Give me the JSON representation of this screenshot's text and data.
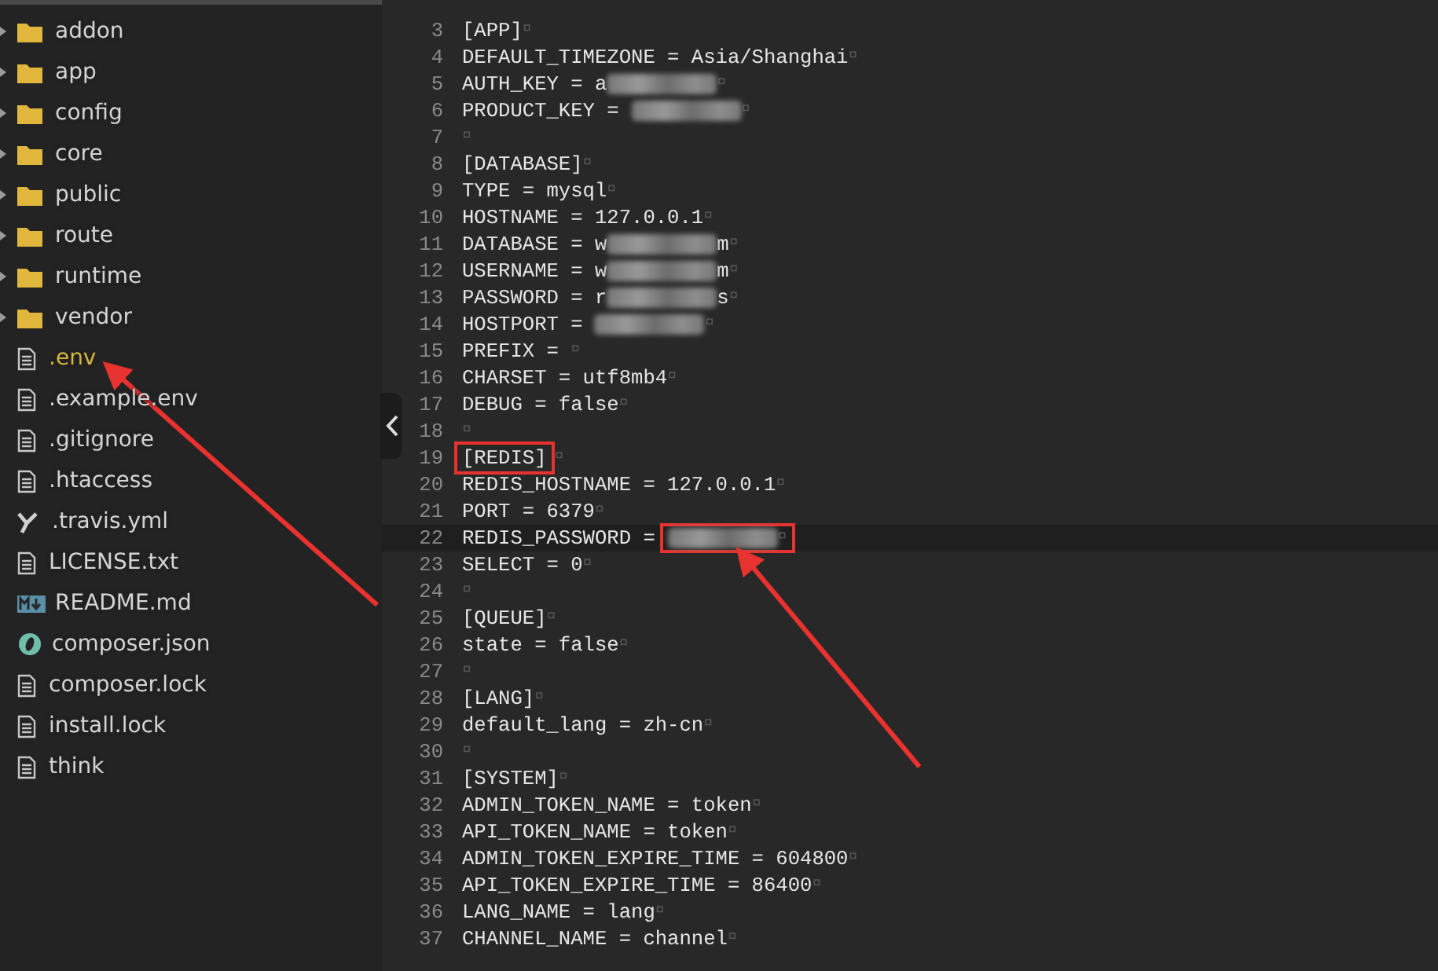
{
  "sidebar": {
    "items": [
      {
        "kind": "folder",
        "label": "addon",
        "selected": false
      },
      {
        "kind": "folder",
        "label": "app",
        "selected": false
      },
      {
        "kind": "folder",
        "label": "config",
        "selected": false
      },
      {
        "kind": "folder",
        "label": "core",
        "selected": false
      },
      {
        "kind": "folder",
        "label": "public",
        "selected": false
      },
      {
        "kind": "folder",
        "label": "route",
        "selected": false
      },
      {
        "kind": "folder",
        "label": "runtime",
        "selected": false
      },
      {
        "kind": "folder",
        "label": "vendor",
        "selected": false
      },
      {
        "kind": "file",
        "label": ".env",
        "selected": true
      },
      {
        "kind": "file",
        "label": ".example.env",
        "selected": false
      },
      {
        "kind": "file",
        "label": ".gitignore",
        "selected": false
      },
      {
        "kind": "file",
        "label": ".htaccess",
        "selected": false
      },
      {
        "kind": "yaml",
        "label": ".travis.yml",
        "selected": false
      },
      {
        "kind": "file",
        "label": "LICENSE.txt",
        "selected": false
      },
      {
        "kind": "markdown",
        "label": "README.md",
        "selected": false
      },
      {
        "kind": "json",
        "label": "composer.json",
        "selected": false
      },
      {
        "kind": "file",
        "label": "composer.lock",
        "selected": false
      },
      {
        "kind": "file",
        "label": "install.lock",
        "selected": false
      },
      {
        "kind": "file",
        "label": "think",
        "selected": false
      }
    ]
  },
  "editor": {
    "lines": [
      {
        "n": "3",
        "text": "[APP]",
        "eol": "¤"
      },
      {
        "n": "4",
        "text": "DEFAULT_TIMEZONE = Asia/Shanghai",
        "eol": "¤"
      },
      {
        "n": "5",
        "text": "AUTH_KEY = a",
        "redacted": true,
        "eol": "¤"
      },
      {
        "n": "6",
        "text": "PRODUCT_KEY = ",
        "redacted": true,
        "eol": "¤"
      },
      {
        "n": "7",
        "eol": "¤"
      },
      {
        "n": "8",
        "text": "[DATABASE]",
        "eol": "¤"
      },
      {
        "n": "9",
        "text": "TYPE = mysql",
        "eol": "¤"
      },
      {
        "n": "10",
        "text": "HOSTNAME = 127.0.0.1",
        "eol": "¤"
      },
      {
        "n": "11",
        "text": "DATABASE = w",
        "redacted": true,
        "after": "m",
        "eol": "¤"
      },
      {
        "n": "12",
        "text": "USERNAME = w",
        "redacted": true,
        "after": "m",
        "eol": "¤"
      },
      {
        "n": "13",
        "text": "PASSWORD = r",
        "redacted": true,
        "after": "s",
        "eol": "¤"
      },
      {
        "n": "14",
        "text": "HOSTPORT = ",
        "redacted": true,
        "eol": "¤"
      },
      {
        "n": "15",
        "text": "PREFIX = ",
        "eol": "¤"
      },
      {
        "n": "16",
        "text": "CHARSET = utf8mb4",
        "eol": "¤"
      },
      {
        "n": "17",
        "text": "DEBUG = false",
        "eol": "¤"
      },
      {
        "n": "18",
        "eol": "¤"
      },
      {
        "n": "19",
        "text": "[REDIS]",
        "eol": "¤",
        "boxed": true
      },
      {
        "n": "20",
        "text": "REDIS_HOSTNAME = 127.0.0.1",
        "eol": "¤"
      },
      {
        "n": "21",
        "text": "PORT = 6379",
        "eol": "¤"
      },
      {
        "n": "22",
        "text": "REDIS_PASSWORD = ",
        "redacted": true,
        "eol": "¤",
        "boxed": true,
        "current": true
      },
      {
        "n": "23",
        "text": "SELECT = 0",
        "eol": "¤"
      },
      {
        "n": "24",
        "eol": "¤"
      },
      {
        "n": "25",
        "text": "[QUEUE]",
        "eol": "¤"
      },
      {
        "n": "26",
        "text": "state = false",
        "eol": "¤"
      },
      {
        "n": "27",
        "eol": "¤"
      },
      {
        "n": "28",
        "text": "[LANG]",
        "eol": "¤"
      },
      {
        "n": "29",
        "text": "default_lang = zh-cn",
        "eol": "¤"
      },
      {
        "n": "30",
        "eol": "¤"
      },
      {
        "n": "31",
        "text": "[SYSTEM]",
        "eol": "¤"
      },
      {
        "n": "32",
        "text": "ADMIN_TOKEN_NAME = token",
        "eol": "¤"
      },
      {
        "n": "33",
        "text": "API_TOKEN_NAME = token",
        "eol": "¤"
      },
      {
        "n": "34",
        "text": "ADMIN_TOKEN_EXPIRE_TIME = 604800",
        "eol": "¤"
      },
      {
        "n": "35",
        "text": "API_TOKEN_EXPIRE_TIME = 86400",
        "eol": "¤"
      },
      {
        "n": "36",
        "text": "LANG_NAME = lang",
        "eol": "¤"
      },
      {
        "n": "37",
        "text": "CHANNEL_NAME = channel",
        "eol": "¤"
      }
    ]
  }
}
